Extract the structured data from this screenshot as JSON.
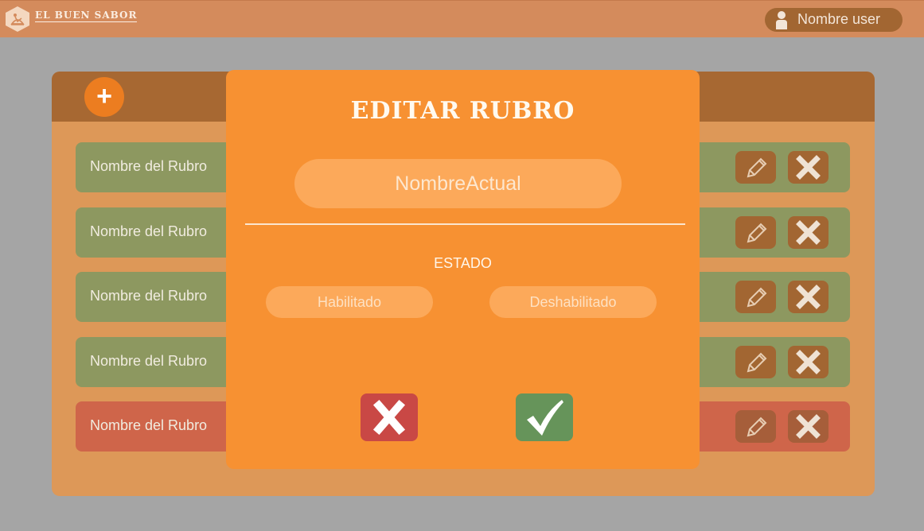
{
  "header": {
    "brand": "EL BUEN SABOR",
    "logo_icon": "chef-hat-logo-icon",
    "user_icon": "user-icon",
    "user_name": "Nombre user"
  },
  "panel": {
    "add_icon": "plus-icon",
    "add_symbol": "+",
    "rows": [
      {
        "label": "Nombre del Rubro",
        "status": "habilitado"
      },
      {
        "label": "Nombre del Rubro",
        "status": "habilitado"
      },
      {
        "label": "Nombre del Rubro",
        "status": "habilitado"
      },
      {
        "label": "Nombre del Rubro",
        "status": "habilitado"
      },
      {
        "label": "Nombre del Rubro",
        "status": "deshabilitado"
      }
    ],
    "edit_icon": "pencil-icon",
    "delete_icon": "close-icon"
  },
  "modal": {
    "title": "EDITAR RUBRO",
    "name_value": "NombreActual",
    "estado_label": "ESTADO",
    "option_enabled": "Habilitado",
    "option_disabled": "Deshabilitado",
    "cancel_icon": "close-icon",
    "confirm_icon": "checkmark-icon"
  },
  "colors": {
    "topbar": "#d48b5c",
    "modal": "#f79132",
    "row_enabled": "#8d9860",
    "row_disabled": "#cf654a",
    "cancel": "#c94845",
    "confirm": "#66945a"
  }
}
